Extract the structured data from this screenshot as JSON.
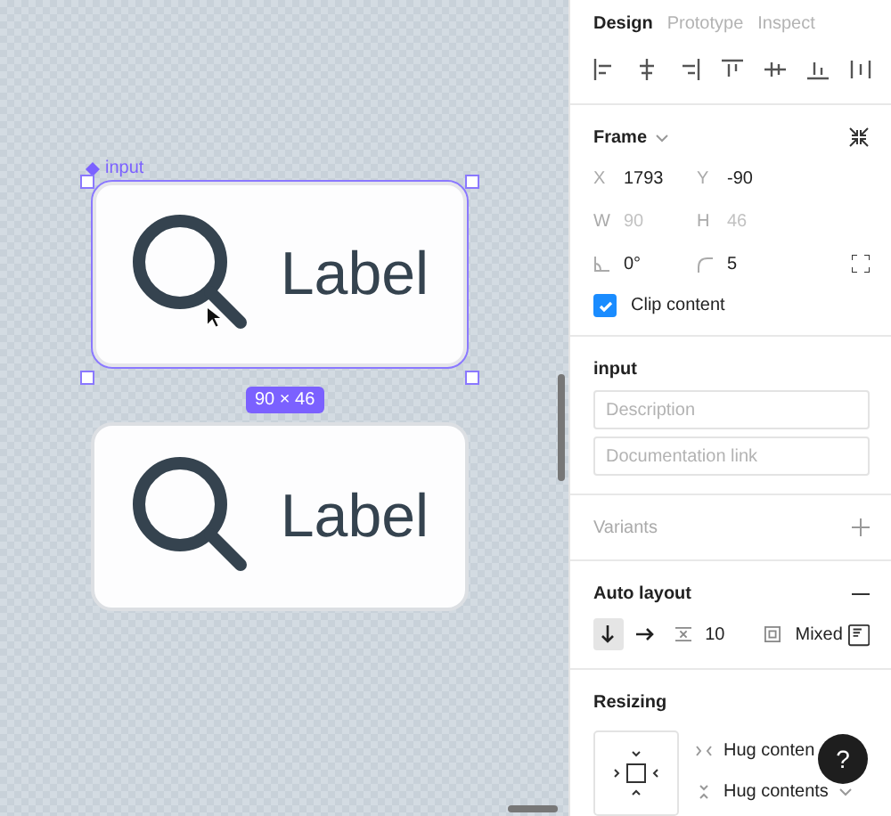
{
  "canvas": {
    "frames": [
      {
        "name": "input",
        "label": "Label",
        "selected": true,
        "size": "90 × 46"
      },
      {
        "label": "Label",
        "selected": false
      }
    ]
  },
  "tabs": [
    {
      "label": "Design",
      "selected": true
    },
    {
      "label": "Prototype",
      "selected": false
    },
    {
      "label": "Inspect",
      "selected": false
    }
  ],
  "frame": {
    "title": "Frame",
    "fields": [
      {
        "label": "X",
        "value": "1793",
        "disabled": false
      },
      {
        "label": "Y",
        "value": "-90",
        "disabled": false
      },
      {
        "label": "W",
        "value": "90",
        "disabled": true
      },
      {
        "label": "H",
        "value": "46",
        "disabled": true
      }
    ],
    "rotation": "0°",
    "radius": "5",
    "clip_content": {
      "label": "Clip content",
      "checked": true
    }
  },
  "component": {
    "title": "input",
    "description": {
      "placeholder": "Description"
    },
    "documentation_link": {
      "placeholder": "Documentation link"
    }
  },
  "variants": {
    "title": "Variants",
    "disabled": true
  },
  "auto_layout": {
    "title": "Auto layout",
    "directions": [
      {
        "kind": "down",
        "selected": true
      },
      {
        "kind": "right",
        "selected": false
      }
    ],
    "spacing": "10",
    "padding": "Mixed"
  },
  "resizing": {
    "title": "Resizing",
    "width": "Hug conten",
    "height": "Hug contents"
  },
  "help": "?"
}
